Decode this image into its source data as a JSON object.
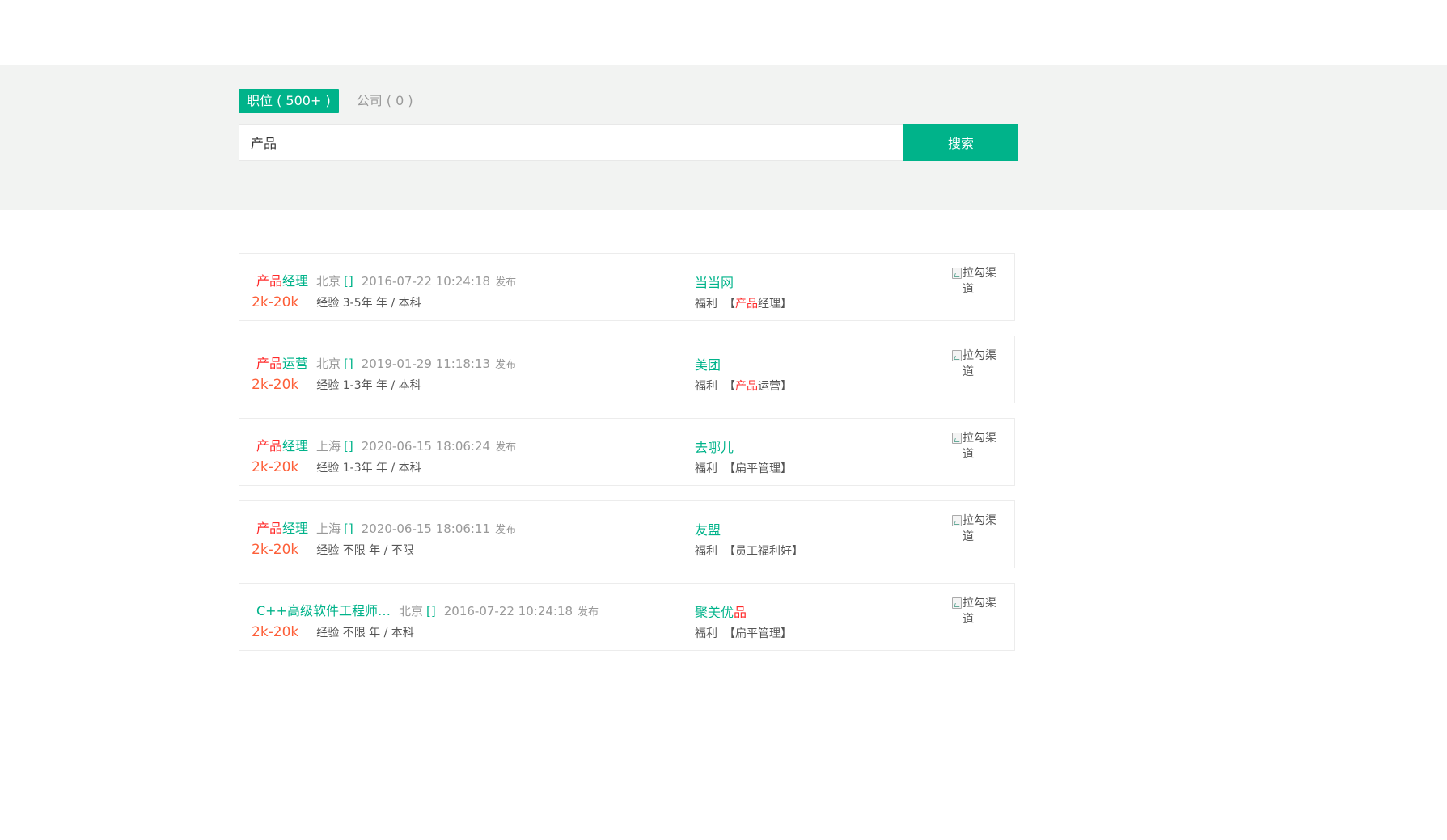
{
  "colors": {
    "accent": "#00b38a",
    "salary": "#fd5f39",
    "highlight": "#ff2a2a",
    "band": "#f2f3f2"
  },
  "tabs": [
    {
      "label": "职位 ( 500+ )",
      "active": true
    },
    {
      "label": "公司 ( 0 )",
      "active": false
    }
  ],
  "search": {
    "value": "产品",
    "button_label": "搜索"
  },
  "jobs": [
    {
      "title_hl": "产品",
      "title_rest": "经理",
      "city": "北京",
      "bracket": "[]",
      "time": "2016-07-22 10:24:18",
      "pub": "发布",
      "salary": "2k-20k",
      "requirement": "经验 3-5年 年 / 本科",
      "company_pre": "当当网",
      "company_hl": "",
      "company_post": "",
      "welfare_label": "福利",
      "welfare_open": "【",
      "welfare_hl": "产品",
      "welfare_rest": "经理】",
      "logo_alt": "拉勾渠道"
    },
    {
      "title_hl": "产品",
      "title_rest": "运营",
      "city": "北京",
      "bracket": "[]",
      "time": "2019-01-29 11:18:13",
      "pub": "发布",
      "salary": "2k-20k",
      "requirement": "经验 1-3年 年 / 本科",
      "company_pre": "美团",
      "company_hl": "",
      "company_post": "",
      "welfare_label": "福利",
      "welfare_open": "【",
      "welfare_hl": "产品",
      "welfare_rest": "运营】",
      "logo_alt": "拉勾渠道"
    },
    {
      "title_hl": "产品",
      "title_rest": "经理",
      "city": "上海",
      "bracket": "[]",
      "time": "2020-06-15 18:06:24",
      "pub": "发布",
      "salary": "2k-20k",
      "requirement": "经验 1-3年 年 / 本科",
      "company_pre": "去哪儿",
      "company_hl": "",
      "company_post": "",
      "welfare_label": "福利",
      "welfare_open": "【",
      "welfare_hl": "",
      "welfare_rest": "扁平管理】",
      "logo_alt": "拉勾渠道"
    },
    {
      "title_hl": "产品",
      "title_rest": "经理",
      "city": "上海",
      "bracket": "[]",
      "time": "2020-06-15 18:06:11",
      "pub": "发布",
      "salary": "2k-20k",
      "requirement": "经验 不限 年 / 不限",
      "company_pre": "友盟",
      "company_hl": "",
      "company_post": "",
      "welfare_label": "福利",
      "welfare_open": "【",
      "welfare_hl": "",
      "welfare_rest": "员工福利好】",
      "logo_alt": "拉勾渠道"
    },
    {
      "title_hl": "",
      "title_rest": "C++高级软件工程师…",
      "city": "北京",
      "bracket": "[]",
      "time": "2016-07-22 10:24:18",
      "pub": "发布",
      "salary": "2k-20k",
      "requirement": "经验 不限 年 / 本科",
      "company_pre": "聚美优",
      "company_hl": "品",
      "company_post": "",
      "welfare_label": "福利",
      "welfare_open": "【",
      "welfare_hl": "",
      "welfare_rest": "扁平管理】",
      "logo_alt": "拉勾渠道"
    }
  ]
}
